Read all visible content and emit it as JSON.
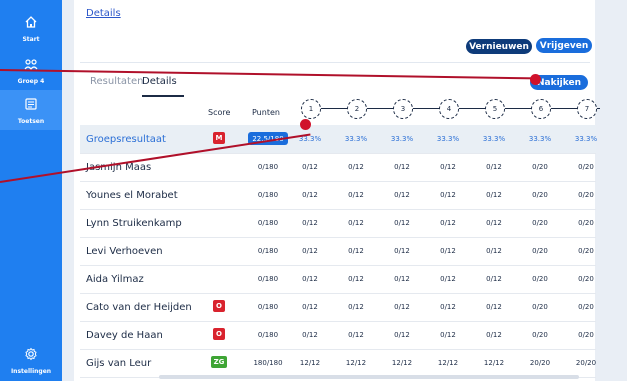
{
  "sidebar": {
    "items": [
      {
        "label": "Start",
        "icon": "home-icon"
      },
      {
        "label": "Groep 4",
        "icon": "group-icon"
      },
      {
        "label": "Toetsen",
        "icon": "tests-icon"
      },
      {
        "label": "Instellingen",
        "icon": "settings-icon"
      }
    ],
    "active": "Toetsen"
  },
  "header": {
    "link": "Details",
    "refresh_label": "Vernieuwen",
    "release_label": "Vrijgeven"
  },
  "tabs": {
    "results_label": "Resultaten",
    "details_label": "Details",
    "active": "Details",
    "grade_label": "Nakijken"
  },
  "table": {
    "score_header": "Score",
    "points_header": "Punten",
    "questions": [
      "1",
      "2",
      "3",
      "4",
      "5",
      "6",
      "7"
    ],
    "group_row": {
      "name": "Groepsresultaat",
      "badge": "M",
      "badge_color": "#d9232e",
      "points": "22.5/180",
      "values": [
        "33.3%",
        "33.3%",
        "33.3%",
        "33.3%",
        "33.3%",
        "33.3%",
        "33.3%"
      ]
    },
    "rows": [
      {
        "name": "Jasmijn Maas",
        "badge": "",
        "badge_color": "",
        "points": "0/180",
        "values": [
          "0/12",
          "0/12",
          "0/12",
          "0/12",
          "0/12",
          "0/20",
          "0/20"
        ]
      },
      {
        "name": "Younes el Morabet",
        "badge": "",
        "badge_color": "",
        "points": "0/180",
        "values": [
          "0/12",
          "0/12",
          "0/12",
          "0/12",
          "0/12",
          "0/20",
          "0/20"
        ]
      },
      {
        "name": "Lynn Struikenkamp",
        "badge": "",
        "badge_color": "",
        "points": "0/180",
        "values": [
          "0/12",
          "0/12",
          "0/12",
          "0/12",
          "0/12",
          "0/20",
          "0/20"
        ]
      },
      {
        "name": "Levi Verhoeven",
        "badge": "",
        "badge_color": "",
        "points": "0/180",
        "values": [
          "0/12",
          "0/12",
          "0/12",
          "0/12",
          "0/12",
          "0/20",
          "0/20"
        ]
      },
      {
        "name": "Aida Yilmaz",
        "badge": "",
        "badge_color": "",
        "points": "0/180",
        "values": [
          "0/12",
          "0/12",
          "0/12",
          "0/12",
          "0/12",
          "0/20",
          "0/20"
        ]
      },
      {
        "name": "Cato van der Heijden",
        "badge": "O",
        "badge_color": "#d9232e",
        "points": "0/180",
        "values": [
          "0/12",
          "0/12",
          "0/12",
          "0/12",
          "0/12",
          "0/20",
          "0/20"
        ]
      },
      {
        "name": "Davey de Haan",
        "badge": "O",
        "badge_color": "#d9232e",
        "points": "0/180",
        "values": [
          "0/12",
          "0/12",
          "0/12",
          "0/12",
          "0/12",
          "0/20",
          "0/20"
        ]
      },
      {
        "name": "Gijs van Leur",
        "badge": "ZG",
        "badge_color": "#3fa535",
        "points": "180/180",
        "values": [
          "12/12",
          "12/12",
          "12/12",
          "12/12",
          "12/12",
          "20/20",
          "20/20"
        ]
      }
    ]
  },
  "colors": {
    "sidebar": "#1f7ff0",
    "accent": "#1a6ddc",
    "pointer": "#d0112b"
  }
}
